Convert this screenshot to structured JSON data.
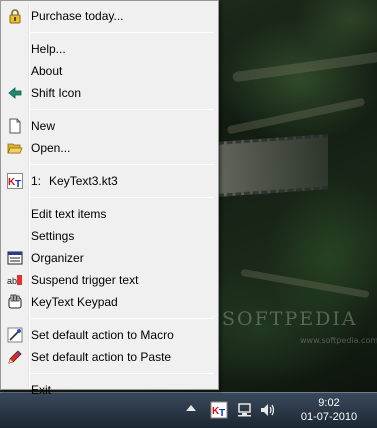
{
  "menu": {
    "purchase": "Purchase today...",
    "help": "Help...",
    "about": "About",
    "shift_icon": "Shift Icon",
    "new": "New",
    "open": "Open...",
    "recent_number": "1:",
    "recent_file": "KeyText3.kt3",
    "edit_text_items": "Edit text items",
    "settings": "Settings",
    "organizer": "Organizer",
    "suspend_trigger": "Suspend trigger text",
    "keypad": "KeyText Keypad",
    "default_macro": "Set default action to Macro",
    "default_paste": "Set default action to Paste",
    "exit": "Exit"
  },
  "taskbar": {
    "time": "9:02",
    "date": "01-07-2010"
  },
  "watermark": {
    "brand": "SOFTPEDIA",
    "url": "www.softpedia.com"
  },
  "colors": {
    "menu_bg": "#f0f0f0",
    "menu_border": "#979797",
    "taskbar_top": "#3a4a5a",
    "taskbar_bottom": "#1c2733"
  }
}
